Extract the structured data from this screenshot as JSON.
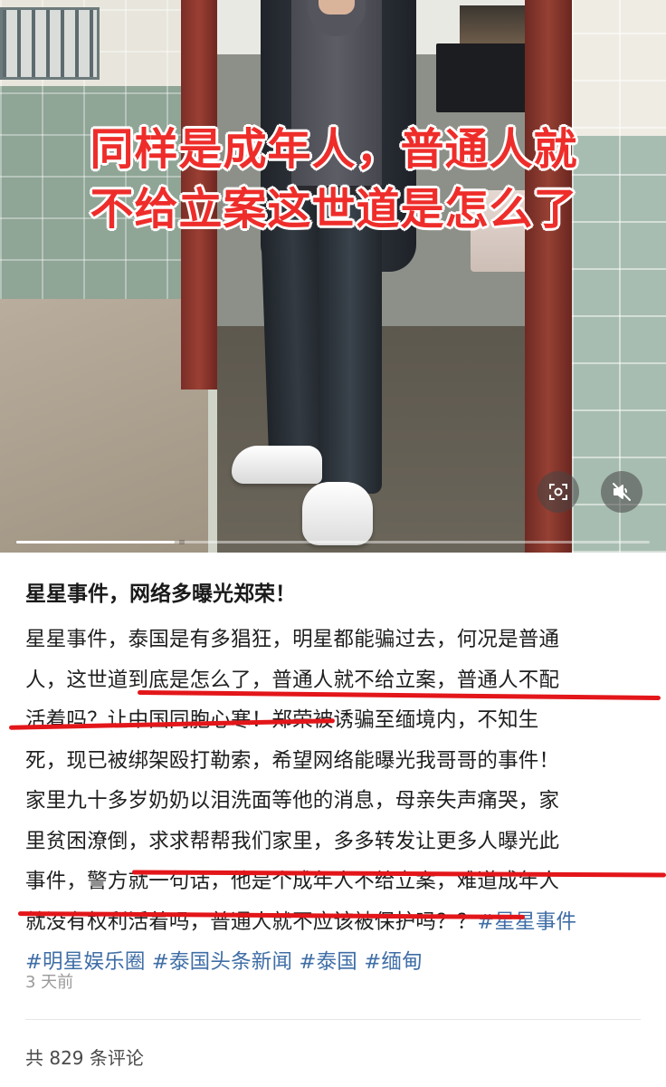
{
  "video": {
    "caption_line1": "同样是成年人，普通人就",
    "caption_line2": "不给立案这世道是怎么了",
    "caption_color": "#ee2d2a",
    "scan_icon": "scan-lens-icon",
    "mute_icon": "muted-speaker-icon",
    "progress": 0.25
  },
  "post": {
    "title": "星星事件，网络多曝光郑荣！",
    "body_lines": [
      "星星事件，泰国是有多猖狂，明星都能骗过去，何况是普通",
      "人，这世道到底是怎么了，普通人就不给立案，普通人不配",
      "活着吗？让中国同胞心寒！郑荣被诱骗至缅境内，不知生",
      "死，现已被绑架殴打勒索，希望网络能曝光我哥哥的事件！",
      "家里九十多岁奶奶以泪洗面等他的消息，母亲失声痛哭，家",
      "里贫困潦倒，求求帮帮我们家里，多多转发让更多人曝光此",
      "事件，警方就一句话，他是个成年人不给立案，难道成年人",
      "就没有权利活着吗，普通人就不应该被保护吗？？"
    ],
    "inline_tag": "#星星事件",
    "tags": [
      "#明星娱乐圈",
      "#泰国头条新闻",
      "#泰国",
      "#缅甸"
    ],
    "tag_color": "#3f6ea6",
    "underline_color": "#e3161a",
    "time": "3 天前",
    "comment_count": "共 829 条评论"
  }
}
